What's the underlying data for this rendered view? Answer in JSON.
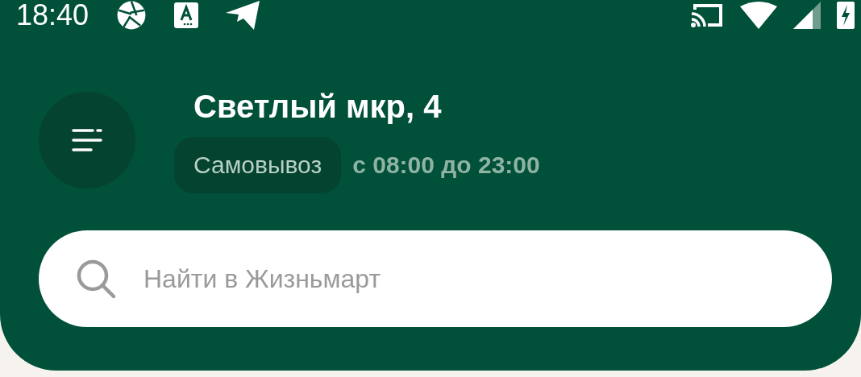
{
  "status_bar": {
    "time": "18:40"
  },
  "header": {
    "address": "Светлый мкр, 4",
    "delivery_mode": "Самовывоз",
    "hours": "с 08:00 до 23:00"
  },
  "search": {
    "placeholder": "Найти в Жизньмарт"
  }
}
